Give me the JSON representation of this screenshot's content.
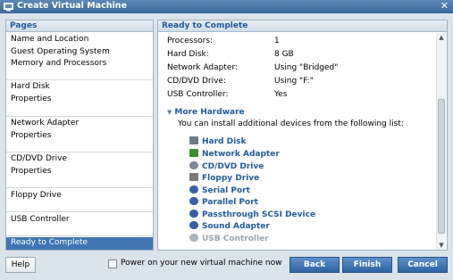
{
  "window": {
    "title": "Create Virtual Machine",
    "close_glyph": "✕"
  },
  "pages": {
    "header": "Pages",
    "items": [
      {
        "line1": "Name and Location",
        "line2": "Guest Operating System",
        "line3": "Memory and Processors"
      },
      {
        "line1": "Hard Disk",
        "line2": "Properties"
      },
      {
        "line1": "Network Adapter",
        "line2": "Properties"
      },
      {
        "line1": "CD/DVD Drive",
        "line2": "Properties"
      },
      {
        "line1": "Floppy Drive"
      },
      {
        "line1": "USB Controller"
      },
      {
        "line1": "Ready to Complete",
        "selected": true
      }
    ]
  },
  "main": {
    "header": "Ready to Complete",
    "properties": [
      {
        "label": "Processors:",
        "value": "1"
      },
      {
        "label": "Hard Disk:",
        "value": "8 GB"
      },
      {
        "label": "Network Adapter:",
        "value": "Using \"Bridged\""
      },
      {
        "label": "CD/DVD Drive:",
        "value": "Using \"F:\""
      },
      {
        "label": "USB Controller:",
        "value": "Yes"
      }
    ],
    "more_hardware": {
      "title": "More Hardware",
      "description": "You can install additional devices from the following list:",
      "items": [
        {
          "label": "Hard Disk",
          "icon": "hard-disk-icon",
          "color": "#6c7a86",
          "enabled": true
        },
        {
          "label": "Network Adapter",
          "icon": "network-adapter-icon",
          "color": "#3a8f2f",
          "enabled": true
        },
        {
          "label": "CD/DVD Drive",
          "icon": "cd-dvd-icon",
          "color": "#7d8a95",
          "enabled": true
        },
        {
          "label": "Floppy Drive",
          "icon": "floppy-icon",
          "color": "#7a7a7a",
          "enabled": true
        },
        {
          "label": "Serial Port",
          "icon": "serial-port-icon",
          "color": "#3560a8",
          "enabled": true
        },
        {
          "label": "Parallel Port",
          "icon": "parallel-port-icon",
          "color": "#3560a8",
          "enabled": true
        },
        {
          "label": "Passthrough SCSI Device",
          "icon": "scsi-icon",
          "color": "#3560a8",
          "enabled": true
        },
        {
          "label": "Sound Adapter",
          "icon": "sound-icon",
          "color": "#3560a8",
          "enabled": true
        },
        {
          "label": "USB Controller",
          "icon": "usb-icon",
          "color": "#a9b3bc",
          "enabled": false
        }
      ]
    }
  },
  "footer": {
    "help": "Help",
    "power_on_label": "Power on your new virtual machine now",
    "power_on_checked": false,
    "back": "Back",
    "finish": "Finish",
    "cancel": "Cancel"
  },
  "colors": {
    "accent": "#1f5a9c",
    "selected": "#3f75b4",
    "titlebar": "#3a6796"
  }
}
